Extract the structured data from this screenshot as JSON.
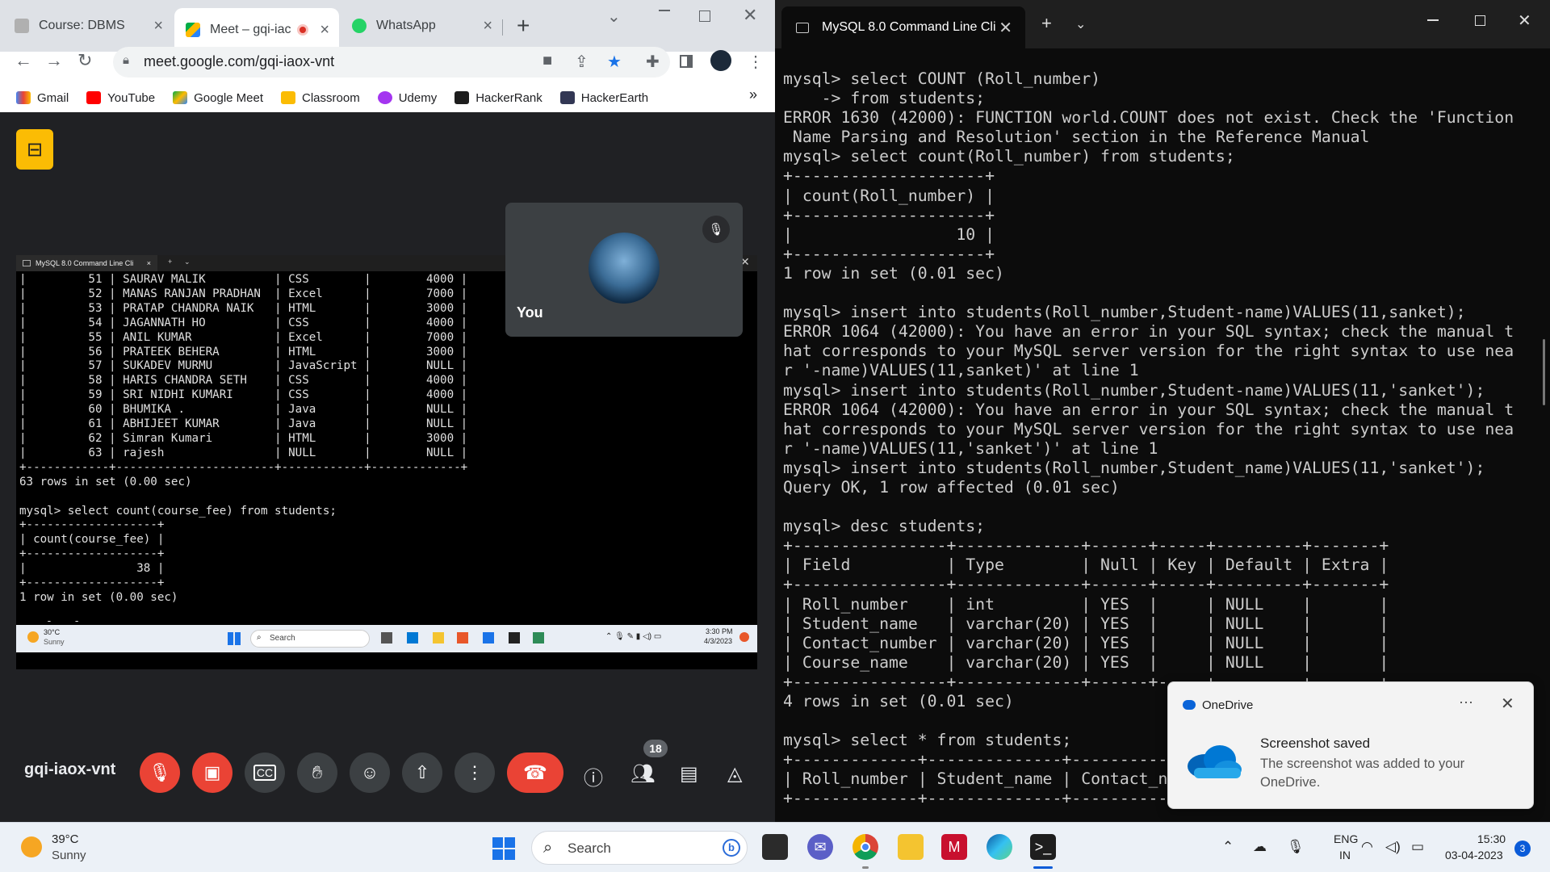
{
  "chrome": {
    "tabs": [
      {
        "label": "Course: DBMS",
        "active": false
      },
      {
        "label": "Meet – gqi-iac",
        "active": true
      },
      {
        "label": "WhatsApp",
        "active": false
      }
    ],
    "url": "meet.google.com/gqi-iaox-vnt",
    "bookmarks": [
      "Gmail",
      "YouTube",
      "Google Meet",
      "Classroom",
      "Udemy",
      "HackerRank",
      "HackerEarth"
    ],
    "bookmarks_more": "»"
  },
  "meet": {
    "meeting_code": "gqi-iaox-vnt",
    "self_tile_name": "You",
    "participants_count": "18",
    "shared_screen": {
      "window_title": "MySQL 8.0 Command Line Cli",
      "terminal_lines": [
        "|         51 | SAURAV MALIK          | CSS        |        4000 |",
        "|         52 | MANAS RANJAN PRADHAN  | Excel      |        7000 |",
        "|         53 | PRATAP CHANDRA NAIK   | HTML       |        3000 |",
        "|         54 | JAGANNATH HO          | CSS        |        4000 |",
        "|         55 | ANIL KUMAR            | Excel      |        7000 |",
        "|         56 | PRATEEK BEHERA        | HTML       |        3000 |",
        "|         57 | SUKADEV MURMU         | JavaScript |        NULL |",
        "|         58 | HARIS CHANDRA SETH    | CSS        |        4000 |",
        "|         59 | SRI NIDHI KUMARI      | CSS        |        4000 |",
        "|         60 | BHUMIKA .             | Java       |        NULL |",
        "|         61 | ABHIJEET KUMAR        | Java       |        NULL |",
        "|         62 | Simran Kumari         | HTML       |        3000 |",
        "|         63 | rajesh                | NULL       |        NULL |",
        "+------------+-----------------------+------------+-------------+",
        "63 rows in set (0.00 sec)",
        "",
        "mysql> select count(course_fee) from students;",
        "+-------------------+",
        "| count(course_fee) |",
        "+-------------------+",
        "|                38 |",
        "+-------------------+",
        "1 row in set (0.00 sec)",
        "",
        "mysql> slec"
      ],
      "taskbar_weather_temp": "30°C",
      "taskbar_weather_desc": "Sunny",
      "taskbar_search": "Search",
      "taskbar_time": "3:30 PM",
      "taskbar_date": "4/3/2023"
    }
  },
  "terminal": {
    "tab_title": "MySQL 8.0 Command Line Cli",
    "lines": [
      "mysql> select COUNT (Roll_number)",
      "    -> from students;",
      "ERROR 1630 (42000): FUNCTION world.COUNT does not exist. Check the 'Function",
      " Name Parsing and Resolution' section in the Reference Manual",
      "mysql> select count(Roll_number) from students;",
      "+--------------------+",
      "| count(Roll_number) |",
      "+--------------------+",
      "|                 10 |",
      "+--------------------+",
      "1 row in set (0.01 sec)",
      "",
      "mysql> insert into students(Roll_number,Student-name)VALUES(11,sanket);",
      "ERROR 1064 (42000): You have an error in your SQL syntax; check the manual t",
      "hat corresponds to your MySQL server version for the right syntax to use nea",
      "r '-name)VALUES(11,sanket)' at line 1",
      "mysql> insert into students(Roll_number,Student-name)VALUES(11,'sanket');",
      "ERROR 1064 (42000): You have an error in your SQL syntax; check the manual t",
      "hat corresponds to your MySQL server version for the right syntax to use nea",
      "r '-name)VALUES(11,'sanket')' at line 1",
      "mysql> insert into students(Roll_number,Student_name)VALUES(11,'sanket');",
      "Query OK, 1 row affected (0.01 sec)",
      "",
      "mysql> desc students;",
      "+----------------+-------------+------+-----+---------+-------+",
      "| Field          | Type        | Null | Key | Default | Extra |",
      "+----------------+-------------+------+-----+---------+-------+",
      "| Roll_number    | int         | YES  |     | NULL    |       |",
      "| Student_name   | varchar(20) | YES  |     | NULL    |       |",
      "| Contact_number | varchar(20) | YES  |     | NULL    |       |",
      "| Course_name    | varchar(20) | YES  |     | NULL    |       |",
      "+----------------+-------------+------+-----+---------+-------+",
      "4 rows in set (0.01 sec)",
      "",
      "mysql> select * from students;",
      "+-------------+--------------+----------------+",
      "| Roll_number | Student_name | Contact_number |",
      "+-------------+--------------+----------------+"
    ]
  },
  "toast": {
    "app": "OneDrive",
    "more": "···",
    "title": "Screenshot saved",
    "body": "The screenshot was added to your OneDrive."
  },
  "taskbar": {
    "weather_temp": "39°C",
    "weather_desc": "Sunny",
    "search_label": "Search",
    "lang_line1": "ENG",
    "lang_line2": "IN",
    "time": "15:30",
    "date": "03-04-2023",
    "notification_count": "3"
  },
  "colors": {
    "meet_end_call": "#ea4335",
    "meet_badge": "#fbbc04",
    "terminal_bg": "#0c0c0c",
    "accent_blue": "#1a73e8"
  }
}
